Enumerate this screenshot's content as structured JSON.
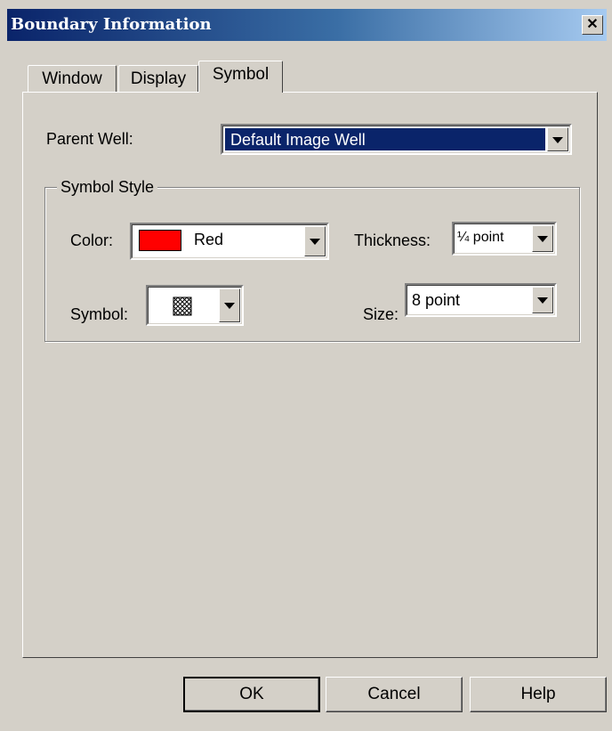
{
  "window": {
    "title": "Boundary Information",
    "close_label": "✕"
  },
  "tabs": [
    {
      "label": "Window",
      "active": false
    },
    {
      "label": "Display",
      "active": false
    },
    {
      "label": "Symbol",
      "active": true
    }
  ],
  "parent_well": {
    "label": "Parent Well:",
    "value": "Default Image Well"
  },
  "symbol_style": {
    "title": "Symbol Style",
    "color": {
      "label": "Color:",
      "value": "Red",
      "swatch": "#ff0000"
    },
    "thickness": {
      "label": "Thickness:",
      "value": "¼ point"
    },
    "symbol": {
      "label": "Symbol:",
      "icon": "crosshatch-symbol-icon"
    },
    "size": {
      "label": "Size:",
      "value": "8 point"
    }
  },
  "buttons": {
    "ok": "OK",
    "cancel": "Cancel",
    "help": "Help"
  },
  "colors": {
    "titlebar_start": "#0a246a",
    "titlebar_end": "#a6caf0",
    "selection": "#0a246a",
    "face": "#d4d0c8"
  }
}
